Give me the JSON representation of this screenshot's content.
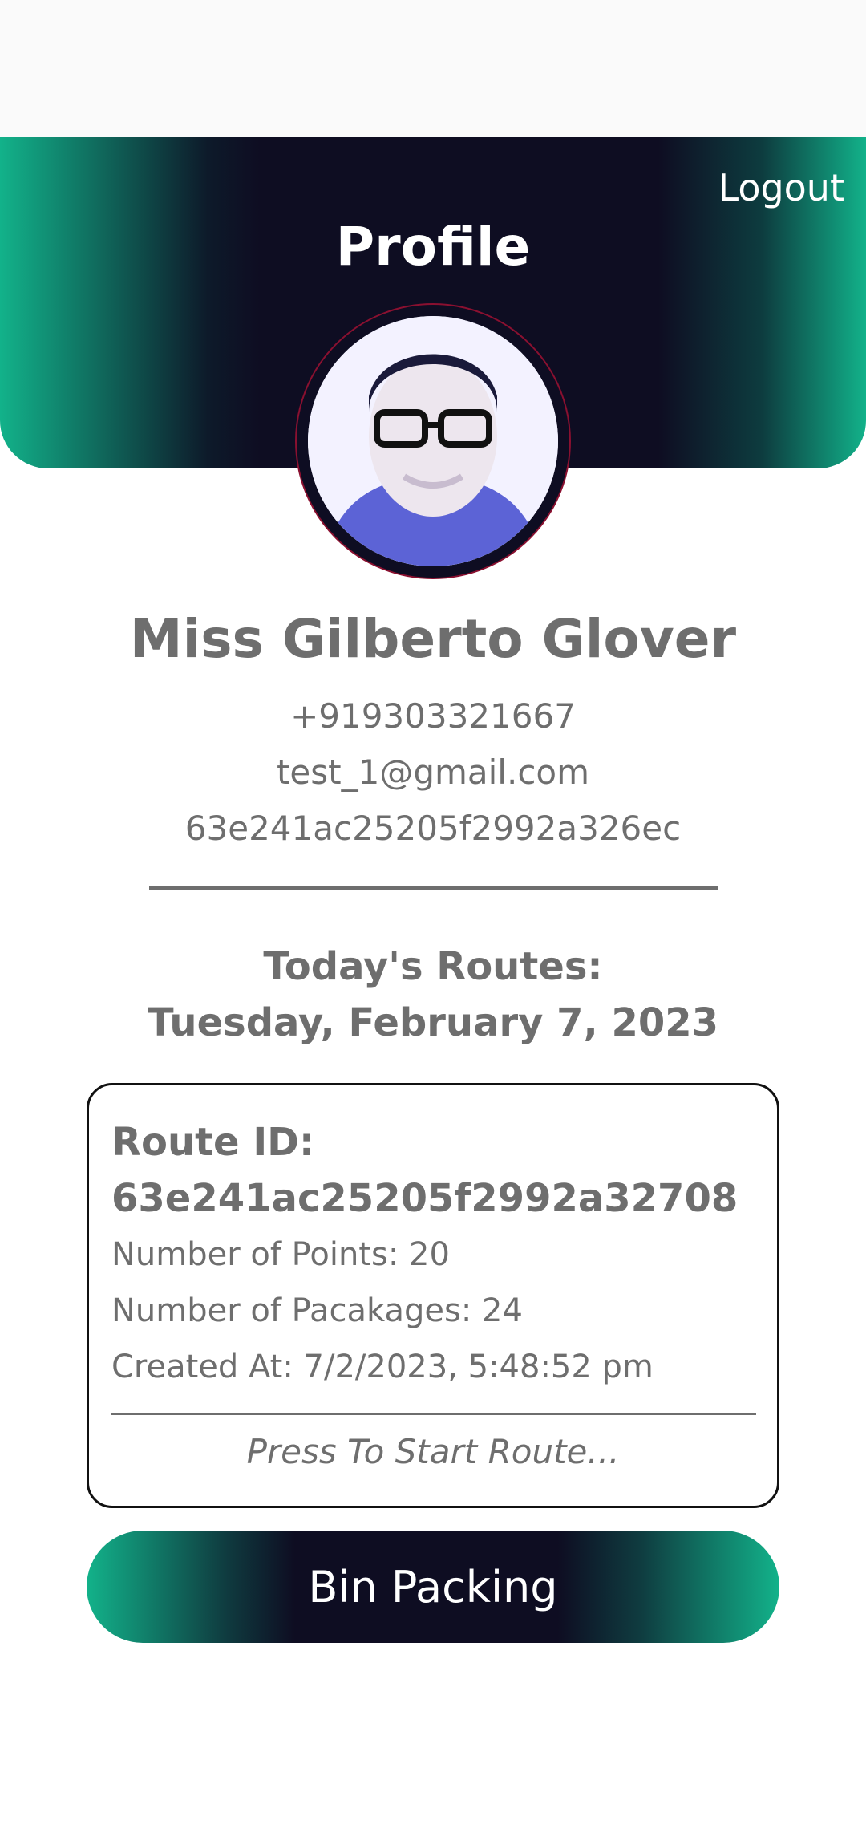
{
  "header": {
    "title": "Profile",
    "logout_label": "Logout"
  },
  "profile": {
    "name": "Miss Gilberto Glover",
    "phone": "+919303321667",
    "email": "test_1@gmail.com",
    "user_id": "63e241ac25205f2992a326ec"
  },
  "routes": {
    "heading": "Today's Routes:",
    "date": "Tuesday, February 7, 2023",
    "items": [
      {
        "id_label": "Route ID:",
        "id": "63e241ac25205f2992a32708",
        "points": "Number of Points: 20",
        "packages": "Number of Pacakages: 24",
        "created": "Created At: 7/2/2023, 5:48:52 pm",
        "action_hint": "Press To Start Route..."
      }
    ]
  },
  "actions": {
    "bin_packing_label": "Bin Packing"
  },
  "colors": {
    "accent_green": "#12b28a",
    "dark_navy": "#0e0d22",
    "text_gray": "#6e6e6e"
  }
}
